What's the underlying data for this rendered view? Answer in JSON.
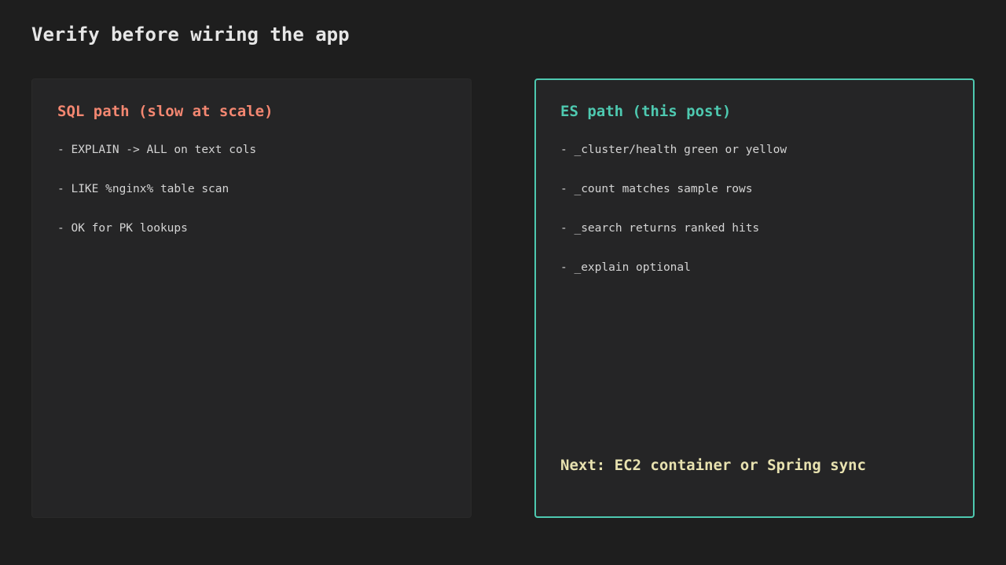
{
  "title": "Verify before wiring the app",
  "colors": {
    "background": "#1e1e1e",
    "card": "#252526",
    "sql_accent": "#f48771",
    "es_accent": "#4ec9b0",
    "next_text": "#e8e2b0"
  },
  "sql_card": {
    "title": "SQL path (slow at scale)",
    "items": [
      "- EXPLAIN -> ALL on text cols",
      "- LIKE %nginx% table scan",
      "- OK for PK lookups"
    ]
  },
  "es_card": {
    "title": "ES path (this post)",
    "items": [
      "- _cluster/health green or yellow",
      "- _count matches sample rows",
      "- _search returns ranked hits",
      "- _explain optional"
    ],
    "next": "Next: EC2 container or Spring sync"
  }
}
